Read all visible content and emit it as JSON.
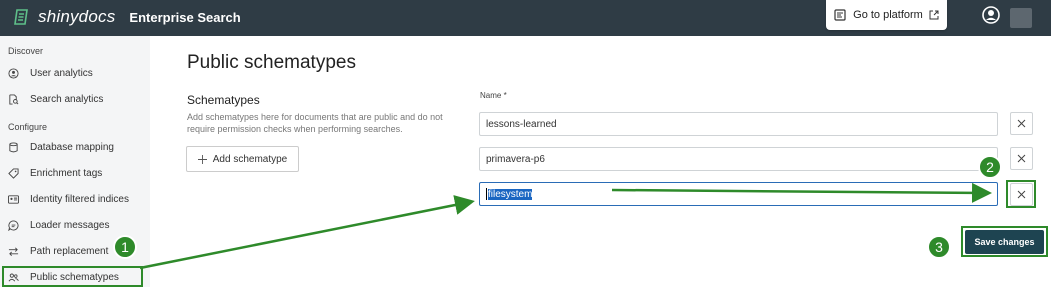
{
  "header": {
    "brand_name": "shinydocs",
    "app_title": "Enterprise Search",
    "goto_label": "Go to platform"
  },
  "sidebar": {
    "sections": [
      {
        "heading": "Discover",
        "items": [
          {
            "label": "User analytics",
            "icon": "user-circle-icon"
          },
          {
            "label": "Search analytics",
            "icon": "search-doc-icon"
          }
        ]
      },
      {
        "heading": "Configure",
        "items": [
          {
            "label": "Database mapping",
            "icon": "database-icon"
          },
          {
            "label": "Enrichment tags",
            "icon": "tag-icon"
          },
          {
            "label": "Identity filtered indices",
            "icon": "id-card-icon"
          },
          {
            "label": "Loader messages",
            "icon": "message-icon"
          },
          {
            "label": "Path replacement",
            "icon": "arrows-swap-icon"
          },
          {
            "label": "Public schematypes",
            "icon": "users-icon",
            "selected": true
          }
        ]
      }
    ]
  },
  "main": {
    "title": "Public schematypes",
    "schematypes_title": "Schematypes",
    "schematypes_desc": "Add schematypes here for documents that are public and do not require permission checks when performing searches.",
    "add_button": "Add schematype",
    "name_label": "Name *",
    "entries": [
      "lessons-learned",
      "primavera-p6",
      "filesystem"
    ],
    "save_button": "Save changes"
  },
  "annotations": {
    "steps": [
      "1",
      "2",
      "3"
    ],
    "color": "#2e8a2a"
  }
}
